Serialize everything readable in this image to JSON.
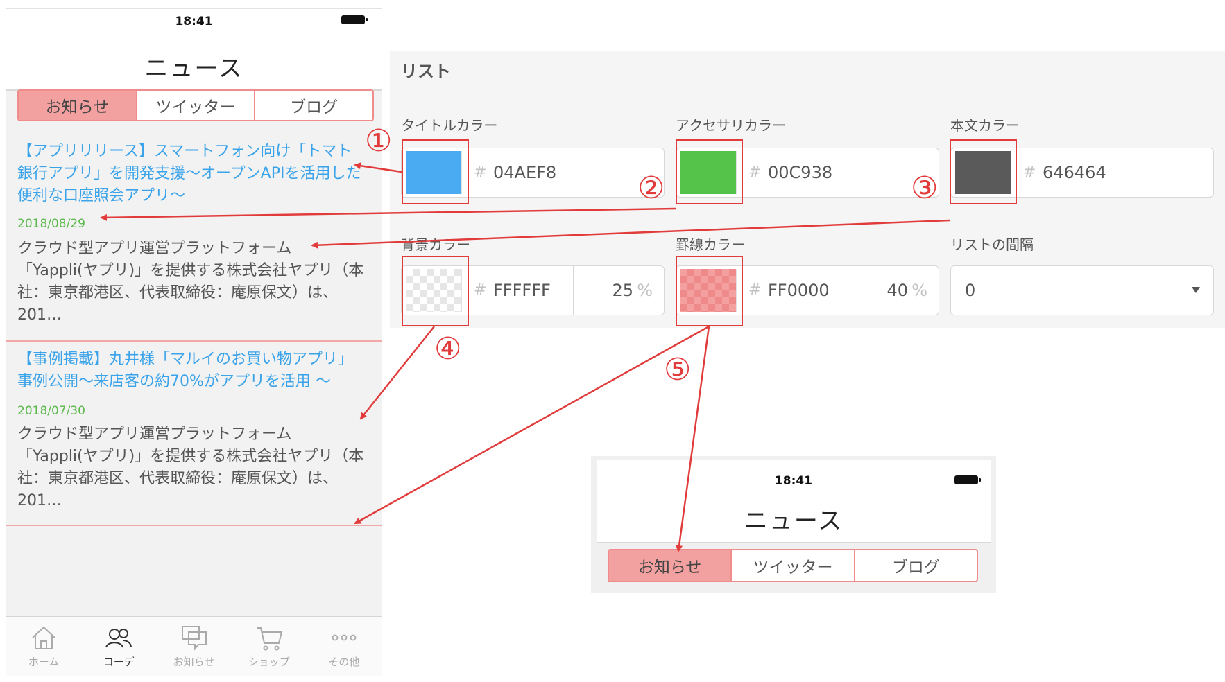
{
  "phone": {
    "status_time": "18:41",
    "nav_title": "ニュース",
    "segments": [
      "お知らせ",
      "ツイッター",
      "ブログ"
    ],
    "active_segment": "お知らせ",
    "news": [
      {
        "title": "【アプリリリース】スマートフォン向け「トマト銀行アプリ」を開発支援～オープンAPIを活用した便利な口座照会アプリ～",
        "date": "2018/08/29",
        "body": "クラウド型アプリ運営プラットフォーム「Yappli(ヤプリ)」を提供する株式会社ヤプリ（本社：東京都港区、代表取締役：庵原保文）は、 201…"
      },
      {
        "title": "【事例掲載】丸井様「マルイのお買い物アプリ」事例公開～来店客の約70%がアプリを活用 ～",
        "date": "2018/07/30",
        "body": "クラウド型アプリ運営プラットフォーム「Yappli(ヤプリ)」を提供する株式会社ヤプリ（本社：東京都港区、代表取締役：庵原保文）は、 201…"
      }
    ],
    "tabs": [
      {
        "label": "ホーム",
        "icon": "home-icon"
      },
      {
        "label": "コーデ",
        "icon": "people-icon"
      },
      {
        "label": "お知らせ",
        "icon": "chat-icon"
      },
      {
        "label": "ショップ",
        "icon": "cart-icon"
      },
      {
        "label": "その他",
        "icon": "more-icon"
      }
    ],
    "active_tab": "コーデ"
  },
  "panel": {
    "title": "リスト",
    "title_color": {
      "label": "タイトルカラー",
      "hash": "#",
      "hex": "04AEF8",
      "swatch": "#4aaaf2"
    },
    "accessory_color": {
      "label": "アクセサリカラー",
      "hash": "#",
      "hex": "00C938",
      "swatch": "#55c24a"
    },
    "body_color": {
      "label": "本文カラー",
      "hash": "#",
      "hex": "646464",
      "swatch": "#5a5a5a"
    },
    "background_color": {
      "label": "背景カラー",
      "hash": "#",
      "hex": "FFFFFF",
      "opacity": "25",
      "unit": "%"
    },
    "rule_color": {
      "label": "罫線カラー",
      "hash": "#",
      "hex": "FF0000",
      "opacity": "40",
      "unit": "%"
    },
    "list_spacing": {
      "label": "リストの間隔",
      "value": "0"
    }
  },
  "markers": [
    "①",
    "②",
    "③",
    "④",
    "⑤"
  ],
  "preview": {
    "status_time": "18:41",
    "nav_title": "ニュース",
    "segments": [
      "お知らせ",
      "ツイッター",
      "ブログ"
    ],
    "active_segment": "お知らせ"
  },
  "colors": {
    "annotation_red": "#e23b3b",
    "link_blue": "#3aa3ea",
    "date_green": "#5ab94a",
    "segment_active": "#f2a0a0",
    "segment_border": "#f08c8c"
  }
}
